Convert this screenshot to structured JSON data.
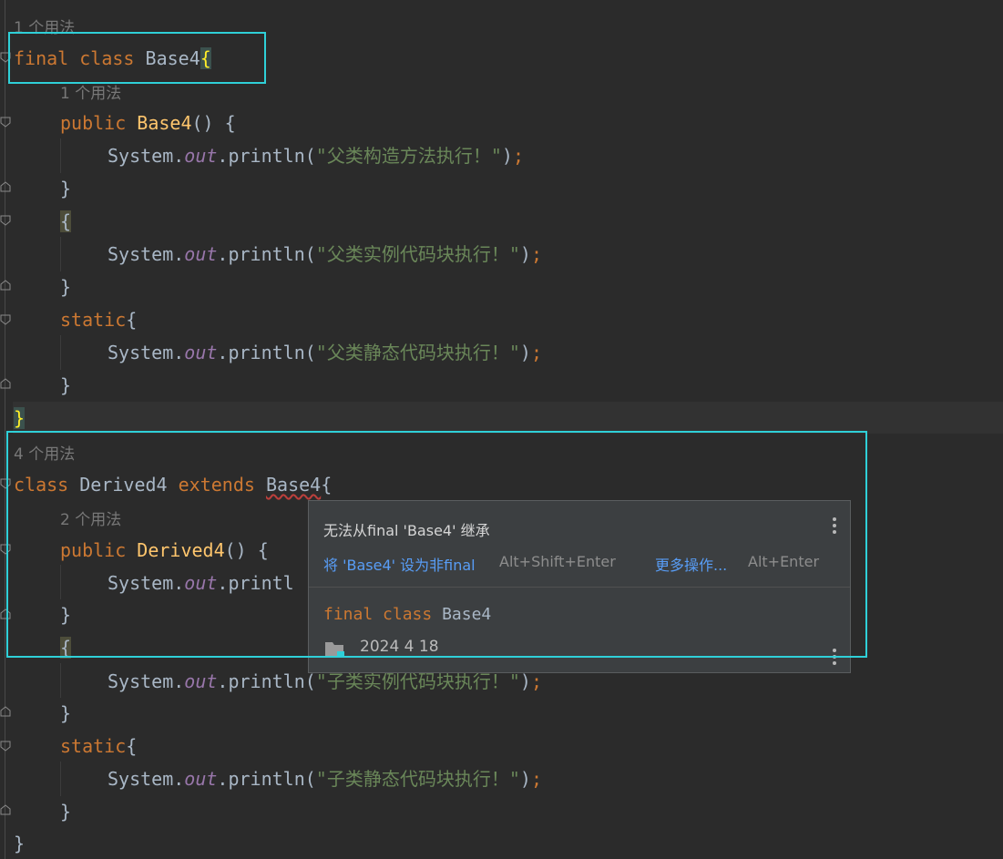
{
  "editor": {
    "hint_base_usages": "1 个用法",
    "hint_base_ctor_usages": "1 个用法",
    "hint_derived_usages": "4 个用法",
    "hint_derived_ctor_usages": "2 个用法",
    "kw_final": "final",
    "kw_class": "class",
    "kw_public": "public",
    "kw_static": "static",
    "kw_extends": "extends",
    "base_name": "Base4",
    "derived_name": "Derived4",
    "sys": "System.",
    "out": "out",
    "println": ".println(",
    "str_base_ctor": "\"父类构造方法执行！\"",
    "str_base_inst": "\"父类实例代码块执行！\"",
    "str_base_static": "\"父类静态代码块执行！\"",
    "str_derived_ctor_partial": "System.",
    "str_derived_inst": "\"子类实例代码块执行！\"",
    "str_derived_static": "\"子类静态代码块执行！\"",
    "println_partial": "printl"
  },
  "popup": {
    "error_message": "无法从final 'Base4' 继承",
    "fix_action_label": "将 'Base4' 设为非final",
    "fix_action_shortcut": "Alt+Shift+Enter",
    "more_actions_label": "更多操作...",
    "more_actions_shortcut": "Alt+Enter",
    "decl_kw_final": "final",
    "decl_kw_class": "class",
    "decl_name": "Base4",
    "location_text": "2024 4 18"
  },
  "colors": {
    "highlight_box": "#2fd0d8",
    "keyword": "#cc7832",
    "method": "#ffc66d",
    "string": "#6a8759",
    "link": "#589df6"
  }
}
